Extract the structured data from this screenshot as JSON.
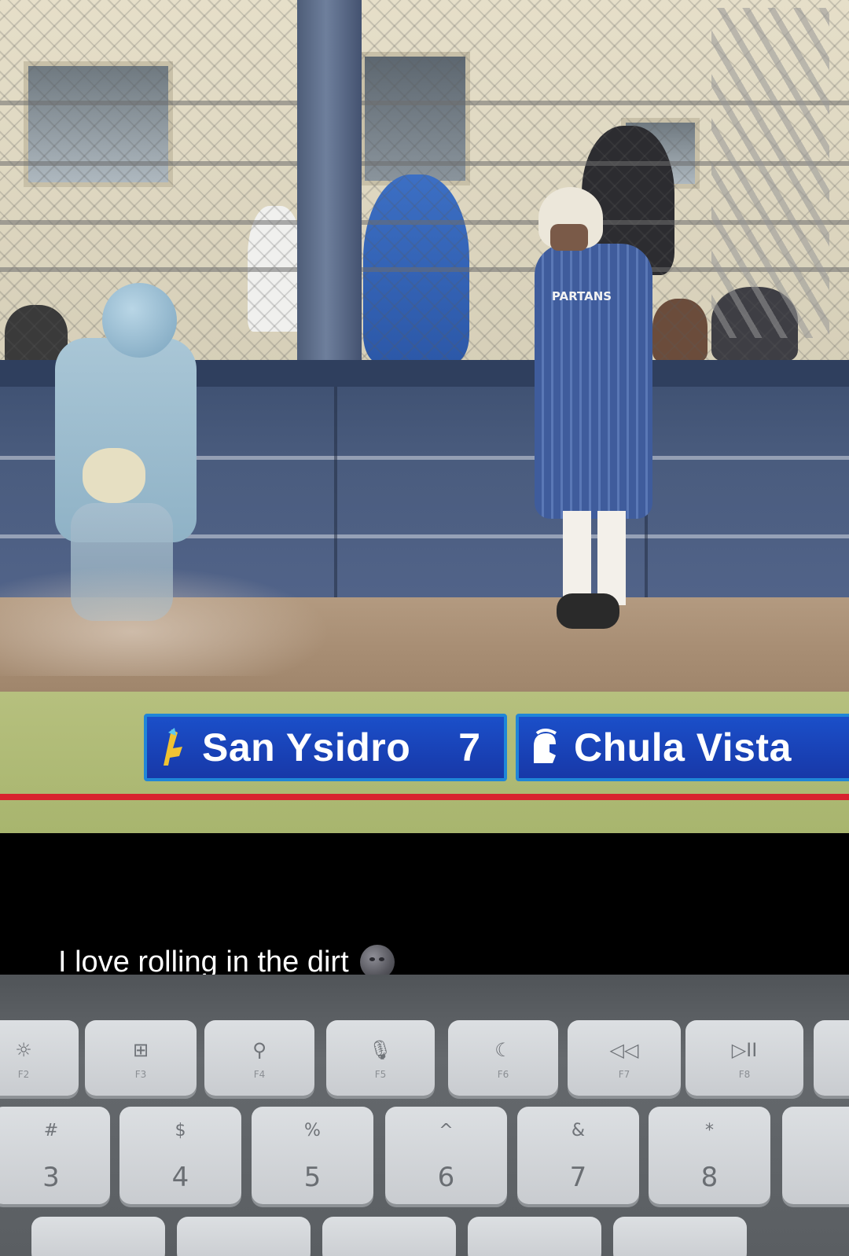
{
  "scorebug": {
    "home_team": "San Ysidro",
    "home_score": "7",
    "away_team": "Chula Vista",
    "colors": {
      "bar": "#1b4fc9",
      "border": "#1f86d8",
      "stripe": "#d8232e"
    },
    "icons": {
      "home": "san-ysidro-logo-icon",
      "away": "spartan-helmet-icon"
    }
  },
  "jersey_text": "PARTANS",
  "caption": {
    "text": "I love rolling in the dirt",
    "emoji": "new-moon-face-emoji"
  },
  "keyboard": {
    "function_keys": [
      {
        "glyph": "☼",
        "label": "F2"
      },
      {
        "glyph": "⊞",
        "label": "F3"
      },
      {
        "glyph": "⚲",
        "label": "F4"
      },
      {
        "glyph": "🎙",
        "label": "F5"
      },
      {
        "glyph": "☾",
        "label": "F6"
      },
      {
        "glyph": "◁◁",
        "label": "F7"
      },
      {
        "glyph": "▷II",
        "label": "F8"
      }
    ],
    "number_keys": [
      {
        "sym": "#",
        "num": "3"
      },
      {
        "sym": "$",
        "num": "4"
      },
      {
        "sym": "%",
        "num": "5"
      },
      {
        "sym": "^",
        "num": "6"
      },
      {
        "sym": "&",
        "num": "7"
      },
      {
        "sym": "*",
        "num": "8"
      }
    ]
  }
}
